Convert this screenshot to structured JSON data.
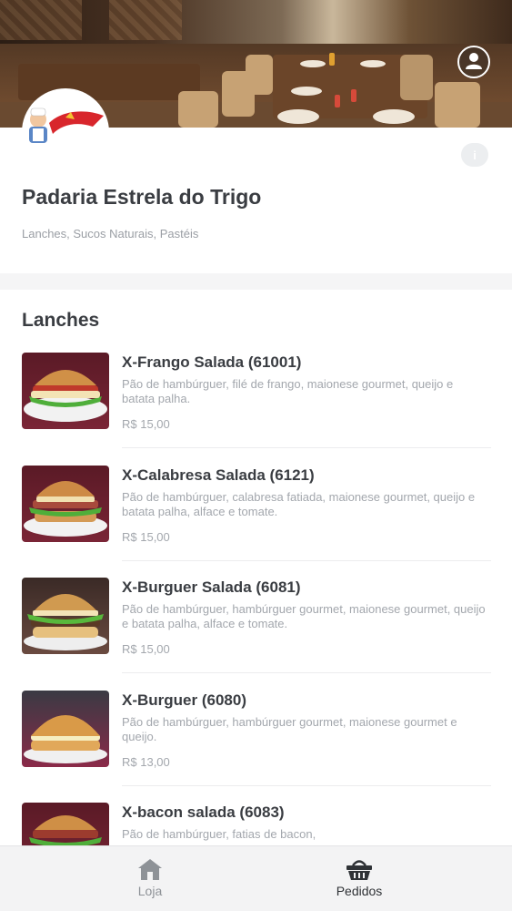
{
  "store": {
    "name": "Padaria Estrela do Trigo",
    "categories": "Lanches, Sucos Naturais, Pastéis",
    "info_icon": "info-icon",
    "profile_icon": "user-profile-icon"
  },
  "colors": {
    "primary_text": "#3a3d42",
    "secondary_text": "#a3a7ad",
    "background": "#f5f5f6",
    "card": "#ffffff",
    "tabbar": "#f3f3f4"
  },
  "menu": {
    "section_title": "Lanches",
    "items": [
      {
        "name": "X-Frango Salada (61001)",
        "description": "Pão de hambúrguer, filé de frango, maionese gourmet, queijo e batata palha.",
        "price": "R$ 15,00"
      },
      {
        "name": "X-Calabresa Salada (6121)",
        "description": "Pão de hambúrguer, calabresa fatiada, maionese gourmet, queijo e batata palha, alface e tomate.",
        "price": "R$ 15,00"
      },
      {
        "name": "X-Burguer Salada (6081)",
        "description": "Pão de hambúrguer, hambúrguer gourmet, maionese gourmet, queijo e batata palha, alface e tomate.",
        "price": "R$ 15,00"
      },
      {
        "name": "X-Burguer (6080)",
        "description": "Pão de hambúrguer, hambúrguer gourmet, maionese gourmet e queijo.",
        "price": "R$ 13,00"
      },
      {
        "name": "X-bacon salada (6083)",
        "description": "Pão de hambúrguer, fatias de bacon,",
        "price": ""
      }
    ]
  },
  "tabs": [
    {
      "label": "Loja",
      "icon": "store-icon"
    },
    {
      "label": "Pedidos",
      "icon": "basket-icon"
    }
  ]
}
